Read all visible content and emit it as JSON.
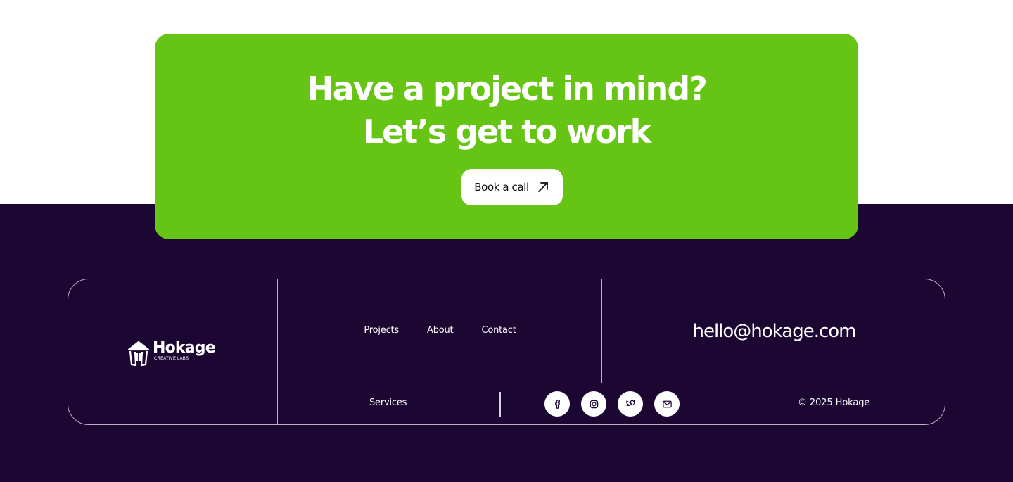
{
  "cta": {
    "heading_line1": "Have a project in mind?",
    "heading_line2": "Let’s get to work",
    "button_label": "Book a call",
    "button_icon": "arrow-up-right-icon",
    "bg_color": "#66c414"
  },
  "footer": {
    "bg_color": "#1c0733",
    "logo": {
      "name": "Hokage",
      "tagline": "CREATIVE LABS"
    },
    "nav": {
      "projects": "Projects",
      "about": "About",
      "contact": "Contact",
      "services": "Services"
    },
    "email": "hello@hokage.com",
    "socials": [
      "facebook-icon",
      "instagram-icon",
      "twitter-icon",
      "mail-icon"
    ],
    "copyright": "© 2025 Hokage"
  }
}
